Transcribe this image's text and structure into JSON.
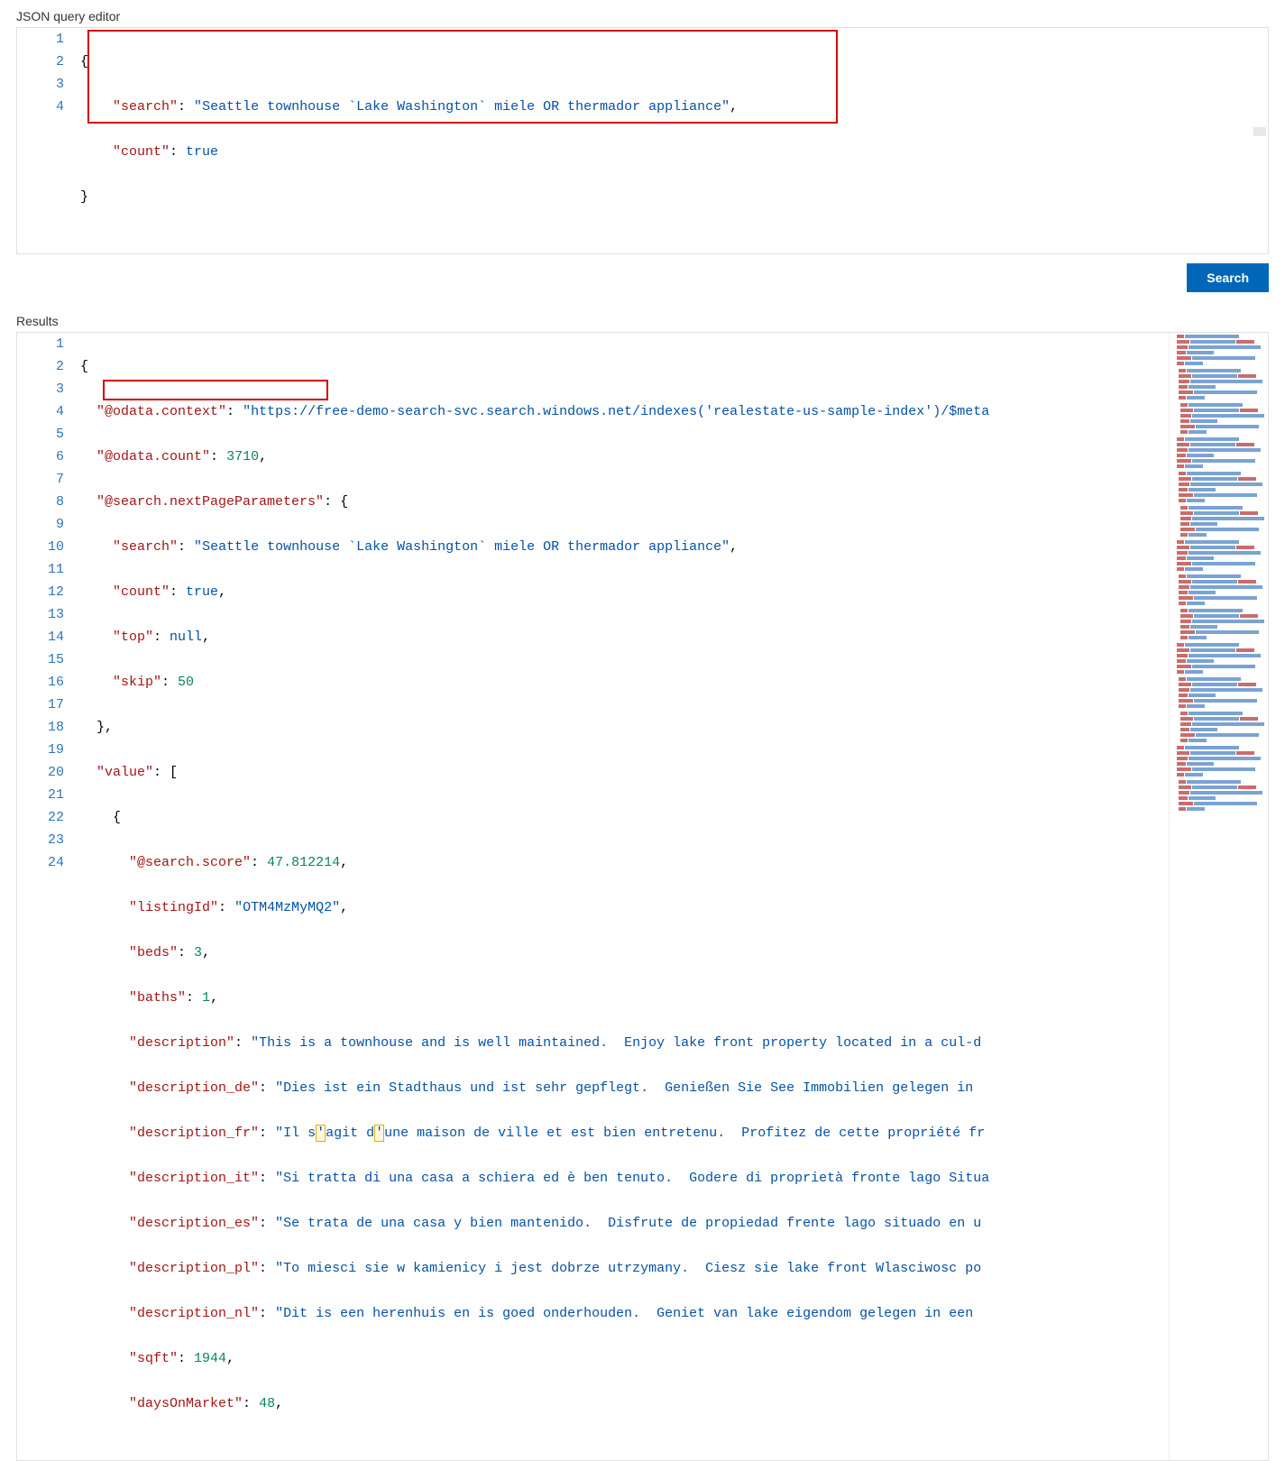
{
  "labels": {
    "query_editor": "JSON query editor",
    "results": "Results",
    "search": "Search"
  },
  "query": {
    "lines": [
      1,
      2,
      3,
      4
    ],
    "raw": "{\n    \"search\": \"Seattle townhouse `Lake Washington` miele OR thermador appliance\",\n    \"count\": true\n}",
    "search": "Seattle townhouse `Lake Washington` miele OR thermador appliance",
    "count": true
  },
  "results": {
    "lines": [
      1,
      2,
      3,
      4,
      5,
      6,
      7,
      8,
      9,
      10,
      11,
      12,
      13,
      14,
      15,
      16,
      17,
      18,
      19,
      20,
      21,
      22,
      23,
      24
    ],
    "odata_context": "https://free-demo-search-svc.search.windows.net/indexes('realestate-us-sample-index')/$meta",
    "odata_count": 3710,
    "nextPageParameters": {
      "search": "Seattle townhouse `Lake Washington` miele OR thermador appliance",
      "count": true,
      "top": null,
      "skip": 50
    },
    "value0": {
      "search_score": 47.812214,
      "listingId": "OTM4MzMyMQ2",
      "beds": 3,
      "baths": 1,
      "description": "This is a townhouse and is well maintained.  Enjoy lake front property located in a cul-d",
      "description_de": "Dies ist ein Stadthaus und ist sehr gepflegt.  Genießen Sie See Immobilien gelegen in ",
      "description_fr_a": "Il s",
      "description_fr_b": "agit d",
      "description_fr_c": "une maison de ville et est bien entretenu.  Profitez de cette propriété fr",
      "description_it": "Si tratta di una casa a schiera ed è ben tenuto.  Godere di proprietà fronte lago Situa",
      "description_es": "Se trata de una casa y bien mantenido.  Disfrute de propiedad frente lago situado en u",
      "description_pl": "To miesci sie w kamienicy i jest dobrze utrzymany.  Ciesz sie lake front Wlasciwosc po",
      "description_nl": "Dit is een herenhuis en is goed onderhouden.  Geniet van lake eigendom gelegen in een ",
      "sqft": 1944,
      "daysOnMarket": 48
    }
  }
}
